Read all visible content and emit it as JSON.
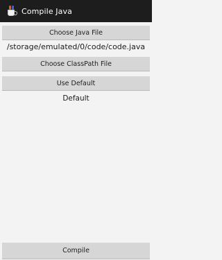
{
  "app": {
    "title": "Compile Java",
    "icon": "java-cup-icon"
  },
  "buttons": {
    "choose_java_file": "Choose Java File",
    "choose_classpath_file": "Choose ClassPath File",
    "use_default": "Use Default",
    "compile": "Compile"
  },
  "java_file_path": "/storage/emulated/0/code/code.java",
  "classpath_value": "Default"
}
